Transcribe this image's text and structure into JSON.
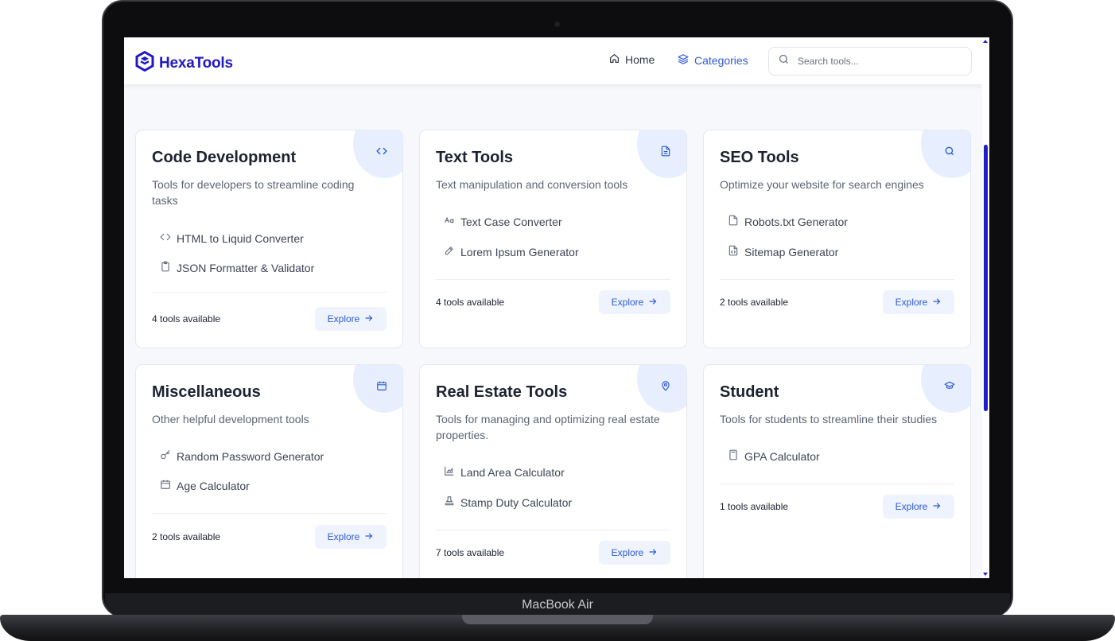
{
  "device": {
    "label": "MacBook Air"
  },
  "header": {
    "logo_text": "HexaTools",
    "nav": [
      {
        "label": "Home",
        "icon": "home-icon"
      },
      {
        "label": "Categories",
        "icon": "layers-icon",
        "active": true
      }
    ],
    "search": {
      "placeholder": "Search tools...",
      "value": ""
    }
  },
  "theme": {
    "accent": "#2f5bd6",
    "brand": "#2019c4",
    "card_blob": "#e7efff",
    "explore_bg": "#eef3fd"
  },
  "cards": [
    {
      "title": "Code Development",
      "icon": "code-icon",
      "description": "Tools for developers to streamline coding tasks",
      "tools": [
        {
          "label": "HTML to Liquid Converter",
          "icon": "code-icon"
        },
        {
          "label": "JSON Formatter & Validator",
          "icon": "clipboard-icon"
        }
      ],
      "count": "4 tools available",
      "explore": "Explore"
    },
    {
      "title": "Text Tools",
      "icon": "document-icon",
      "description": "Text manipulation and conversion tools",
      "tools": [
        {
          "label": "Text Case Converter",
          "icon": "case-icon"
        },
        {
          "label": "Lorem Ipsum Generator",
          "icon": "pencil-icon"
        }
      ],
      "count": "4 tools available",
      "explore": "Explore"
    },
    {
      "title": "SEO Tools",
      "icon": "search-icon",
      "description": "Optimize your website for search engines",
      "tools": [
        {
          "label": "Robots.txt Generator",
          "icon": "file-icon"
        },
        {
          "label": "Sitemap Generator",
          "icon": "file-code-icon"
        }
      ],
      "count": "2 tools available",
      "explore": "Explore"
    },
    {
      "title": "Miscellaneous",
      "icon": "calendar-icon",
      "description": "Other helpful development tools",
      "tools": [
        {
          "label": "Random Password Generator",
          "icon": "key-icon"
        },
        {
          "label": "Age Calculator",
          "icon": "calendar-icon"
        }
      ],
      "count": "2 tools available",
      "explore": "Explore"
    },
    {
      "title": "Real Estate Tools",
      "icon": "map-pin-icon",
      "description": "Tools for managing and optimizing real estate properties.",
      "tools": [
        {
          "label": "Land Area Calculator",
          "icon": "area-chart-icon"
        },
        {
          "label": "Stamp Duty Calculator",
          "icon": "stamp-icon"
        }
      ],
      "count": "7 tools available",
      "explore": "Explore"
    },
    {
      "title": "Student",
      "icon": "graduation-cap-icon",
      "description": "Tools for students to streamline their studies",
      "tools": [
        {
          "label": "GPA Calculator",
          "icon": "calculator-icon"
        }
      ],
      "count": "1 tools available",
      "explore": "Explore"
    }
  ]
}
